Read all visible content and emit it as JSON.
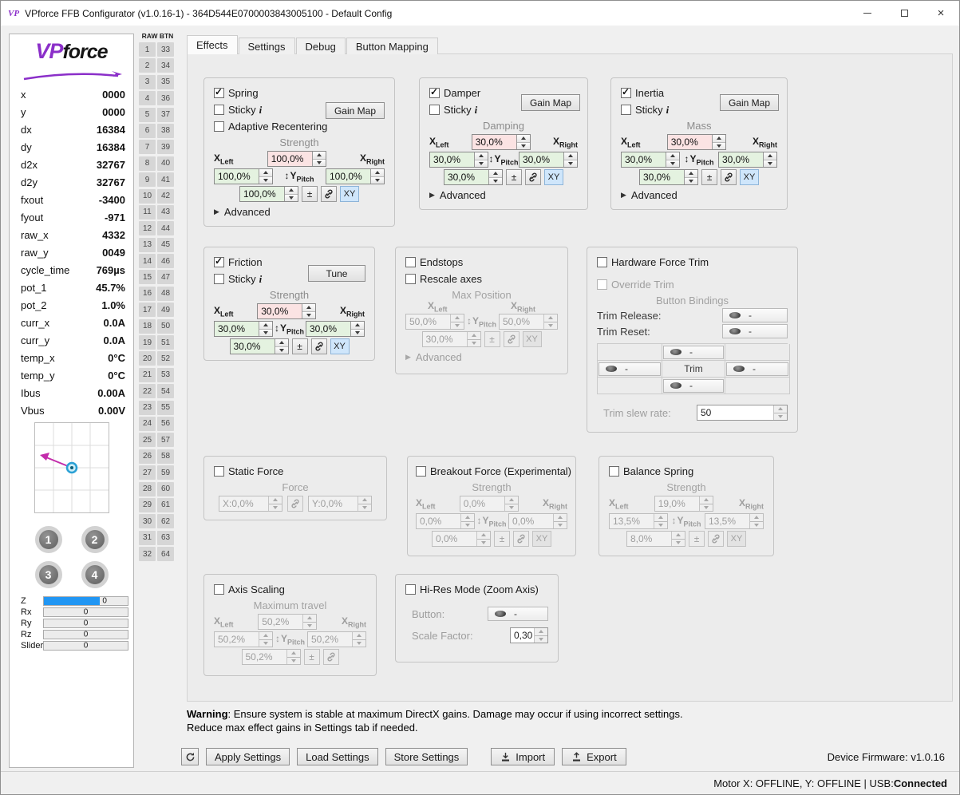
{
  "titlebar": {
    "title": "VPforce FFB Configurator (v1.0.16-1) - 364D544E0700003843005100 - Default Config"
  },
  "icons": {
    "app": "vpforce-logo",
    "minimize": "line-shape",
    "maximize": "square-shape",
    "close": "×",
    "refresh": "circular-arrow",
    "import": "tray-down-arrow",
    "export": "tray-up-arrow",
    "link": "chain",
    "hat_switch": "oval",
    "spinner_up": "triangle-up",
    "spinner_down": "triangle-down"
  },
  "colors": {
    "spinner_pink": "#fbe3e3",
    "spinner_green": "#e4f2e0",
    "xy_active_bg": "#cfe6fb",
    "z_axis_fill": "#2196f3",
    "arrow_magenta": "#c32cab",
    "marker_cyan": "#2aa0d5",
    "logo_purple": "#8b2fc9"
  },
  "sidebar": {
    "logo": {
      "vp": "VP",
      "force": "force"
    },
    "telemetry": [
      {
        "label": "x",
        "value": "0000"
      },
      {
        "label": "y",
        "value": "0000"
      },
      {
        "label": "dx",
        "value": "16384"
      },
      {
        "label": "dy",
        "value": "16384"
      },
      {
        "label": "d2x",
        "value": "32767"
      },
      {
        "label": "d2y",
        "value": "32767"
      },
      {
        "label": "fxout",
        "value": "-3400"
      },
      {
        "label": "fyout",
        "value": "-971"
      },
      {
        "label": "raw_x",
        "value": "4332"
      },
      {
        "label": "raw_y",
        "value": "0049"
      },
      {
        "label": "cycle_time",
        "value": "769µs"
      },
      {
        "label": "pot_1",
        "value": "45.7%"
      },
      {
        "label": "pot_2",
        "value": "1.0%"
      },
      {
        "label": "curr_x",
        "value": "0.0A"
      },
      {
        "label": "curr_y",
        "value": "0.0A"
      },
      {
        "label": "temp_x",
        "value": "0°C"
      },
      {
        "label": "temp_y",
        "value": "0°C"
      },
      {
        "label": "Ibus",
        "value": "0.00A"
      },
      {
        "label": "Vbus",
        "value": "0.00V"
      }
    ],
    "buttons": [
      "1",
      "2",
      "3",
      "4"
    ],
    "axes": [
      {
        "label": "Z",
        "value": "0",
        "fill_percent": 67
      },
      {
        "label": "Rx",
        "value": "0",
        "fill_percent": 0
      },
      {
        "label": "Ry",
        "value": "0",
        "fill_percent": 0
      },
      {
        "label": "Rz",
        "value": "0",
        "fill_percent": 0
      },
      {
        "label": "Slider",
        "value": "0",
        "fill_percent": 0
      }
    ]
  },
  "raw_btn": {
    "header": "RAW BTN",
    "col1": [
      "1",
      "2",
      "3",
      "4",
      "5",
      "6",
      "7",
      "8",
      "9",
      "10",
      "11",
      "12",
      "13",
      "14",
      "15",
      "16",
      "17",
      "18",
      "19",
      "20",
      "21",
      "22",
      "23",
      "24",
      "25",
      "26",
      "27",
      "28",
      "29",
      "30",
      "31",
      "32"
    ],
    "col2": [
      "33",
      "34",
      "35",
      "36",
      "37",
      "38",
      "39",
      "40",
      "41",
      "42",
      "43",
      "44",
      "45",
      "46",
      "47",
      "48",
      "49",
      "50",
      "51",
      "52",
      "53",
      "54",
      "55",
      "56",
      "57",
      "58",
      "59",
      "60",
      "61",
      "62",
      "63",
      "64"
    ]
  },
  "tabs": [
    {
      "label": "Effects",
      "active": true
    },
    {
      "label": "Settings",
      "active": false
    },
    {
      "label": "Debug",
      "active": false
    },
    {
      "label": "Button Mapping",
      "active": false
    }
  ],
  "common": {
    "x": "X",
    "y": "Y",
    "left": "Left",
    "right": "Right",
    "pitch": "Pitch",
    "updown_icon": "↕",
    "plus_minus": "±",
    "xy": "XY",
    "advanced": "Advanced",
    "expander_icon": "▶",
    "sticky_info": "i"
  },
  "groups": {
    "spring": {
      "title": "Spring",
      "checked": true,
      "sticky": "Sticky",
      "sticky_checked": false,
      "adaptive": "Adaptive Recentering",
      "adaptive_checked": false,
      "gain_map": "Gain Map",
      "param_label": "Strength",
      "top": "100,0%",
      "left": "100,0%",
      "right": "100,0%",
      "bottom": "100,0%"
    },
    "damper": {
      "title": "Damper",
      "checked": true,
      "sticky": "Sticky",
      "sticky_checked": false,
      "gain_map": "Gain Map",
      "param_label": "Damping",
      "top": "30,0%",
      "left": "30,0%",
      "right": "30,0%",
      "bottom": "30,0%"
    },
    "inertia": {
      "title": "Inertia",
      "checked": true,
      "sticky": "Sticky",
      "sticky_checked": false,
      "gain_map": "Gain Map",
      "param_label": "Mass",
      "top": "30,0%",
      "left": "30,0%",
      "right": "30,0%",
      "bottom": "30,0%"
    },
    "friction": {
      "title": "Friction",
      "checked": true,
      "sticky": "Sticky",
      "sticky_checked": false,
      "tune": "Tune",
      "param_label": "Strength",
      "top": "30,0%",
      "left": "30,0%",
      "right": "30,0%",
      "bottom": "30,0%"
    },
    "endstops": {
      "title": "Endstops",
      "checked": false,
      "rescale": "Rescale axes",
      "rescale_checked": false,
      "param_label": "Max Position",
      "left": "50,0%",
      "right": "50,0%",
      "bottom": "30,0%"
    },
    "hardware_trim": {
      "title": "Hardware Force Trim",
      "checked": false,
      "override": "Override Trim",
      "override_checked": false,
      "bindings_label": "Button Bindings",
      "trim_release_label": "Trim Release:",
      "trim_reset_label": "Trim Reset:",
      "binding_value": "-",
      "trim_label": "Trim",
      "slew_label": "Trim slew rate:",
      "slew_value": "50"
    },
    "static_force": {
      "title": "Static Force",
      "checked": false,
      "param_label": "Force",
      "x_value": "X:0,0%",
      "y_value": "Y:0,0%"
    },
    "breakout": {
      "title": "Breakout Force (Experimental)",
      "checked": false,
      "param_label": "Strength",
      "top": "0,0%",
      "left": "0,0%",
      "right": "0,0%",
      "bottom": "0,0%"
    },
    "balance": {
      "title": "Balance Spring",
      "checked": false,
      "param_label": "Strength",
      "top": "19,0%",
      "left": "13,5%",
      "right": "13,5%",
      "bottom": "8,0%"
    },
    "axis_scaling": {
      "title": "Axis Scaling",
      "checked": false,
      "param_label": "Maximum travel",
      "top": "50,2%",
      "left": "50,2%",
      "right": "50,2%",
      "bottom": "50,2%"
    },
    "hires": {
      "title": "Hi-Res Mode (Zoom Axis)",
      "checked": false,
      "button_label": "Button:",
      "button_value": "-",
      "scale_label": "Scale Factor:",
      "scale_value": "0,30"
    }
  },
  "warning": {
    "bold": "Warning",
    "line1": ": Ensure system is stable at maximum DirectX gains. Damage may occur if using incorrect settings.",
    "line2": "Reduce max effect gains in Settings tab if needed."
  },
  "toolbar": {
    "apply": "Apply Settings",
    "load": "Load Settings",
    "store": "Store Settings",
    "import": "Import",
    "export": "Export",
    "firmware": "Device Firmware: v1.0.16"
  },
  "statusbar": {
    "text": "Motor X: OFFLINE, Y: OFFLINE | USB: ",
    "usb_status": "Connected"
  }
}
